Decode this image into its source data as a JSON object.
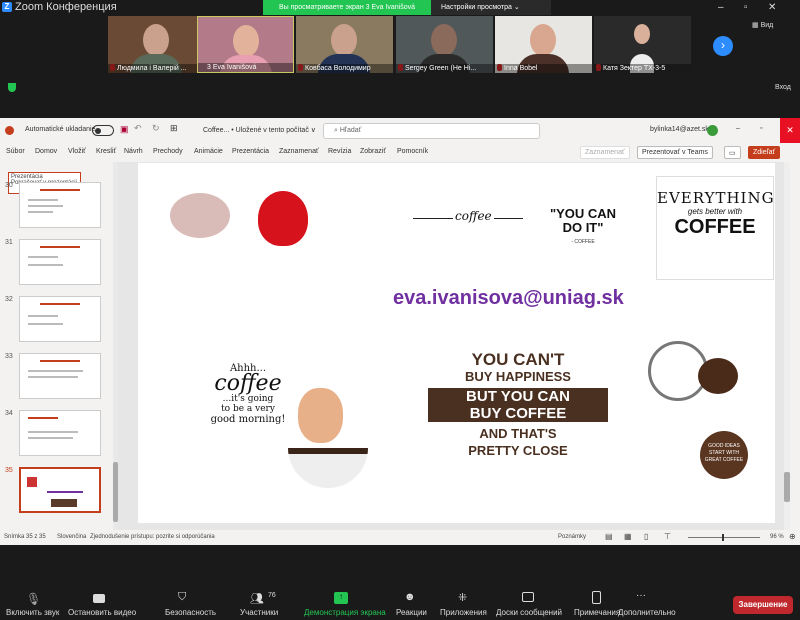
{
  "zoom": {
    "title": "Zoom Конференция",
    "share_banner": "Вы просматриваете экран 3 Eva Ivanišová",
    "view_options": "Настройки просмотра",
    "participants": [
      {
        "name": "Людмила і Валерій ..."
      },
      {
        "name": "3 Eva Ivanišová"
      },
      {
        "name": "Ковбаса Володимир"
      },
      {
        "name": "Sergey Green (Не Hi..."
      },
      {
        "name": "Inna Bobel"
      },
      {
        "name": "Катя Зектер ТХ-3-5"
      }
    ],
    "view_label": "Вид",
    "enter_label": "Вход",
    "toolbar": {
      "mic": "Включить звук",
      "video": "Остановить видео",
      "security": "Безопасность",
      "participants": "Участники",
      "participants_count": "76",
      "share": "Демонстрация экрана",
      "reactions": "Реакции",
      "apps": "Приложения",
      "whiteboards": "Доски сообщений",
      "notes": "Примечания",
      "more": "Дополнительно",
      "end": "Завершение"
    },
    "accent": "#23c552"
  },
  "ppt": {
    "autosave": "Automatické ukladanie",
    "filename": "Coffee... • Uložené v tento počítač ∨",
    "search_placeholder": "Hľadať",
    "account": "bylinka14@azet.sk",
    "tabs": [
      "Súbor",
      "Domov",
      "Vložiť",
      "Kresliť",
      "Návrh",
      "Prechody",
      "Animácie",
      "Prezentácia",
      "Zaznamenať",
      "Revízia",
      "Zobraziť",
      "Pomocník"
    ],
    "record_btn": "Zaznamenať",
    "teams_btn": "Prezentovať v Teams",
    "share_btn": "Zdieľať",
    "tooltip": {
      "title": "Prezentácia",
      "item": "Pokračovať v prezentácii"
    },
    "slides": [
      "30",
      "31",
      "32",
      "33",
      "34",
      "35"
    ],
    "slide": {
      "email": "eva.ivanisova@uniag.sk",
      "coffee_word": "coffee",
      "you_can": "\"YOU CAN DO IT\"",
      "you_can_sub": "- COFFEE",
      "everything": "EVERYTHING",
      "gets_better": "gets better with",
      "coffee_big": "COFFEE",
      "ahhh": "Ahhh...",
      "ahhh_coffee": "coffee",
      "going": "...it's going",
      "very": "to be a very",
      "morning": "good morning!",
      "q1": "YOU CAN'T",
      "q2": "BUY HAPPINESS",
      "q3": "BUT YOU CAN",
      "q4": "BUY COFFEE",
      "q5": "AND THAT'S",
      "q6": "PRETTY CLOSE",
      "bulb": "GOOD IDEAS START WITH GREAT COFFEE"
    },
    "status": {
      "slide_count": "Snímka 35 z 35",
      "language": "Slovenčina",
      "accessibility": "Zjednodušenie prístupu: pozrite si odporúčania",
      "notes": "Poznámky",
      "zoom": "96 %"
    },
    "brand": "#c43e1c"
  }
}
